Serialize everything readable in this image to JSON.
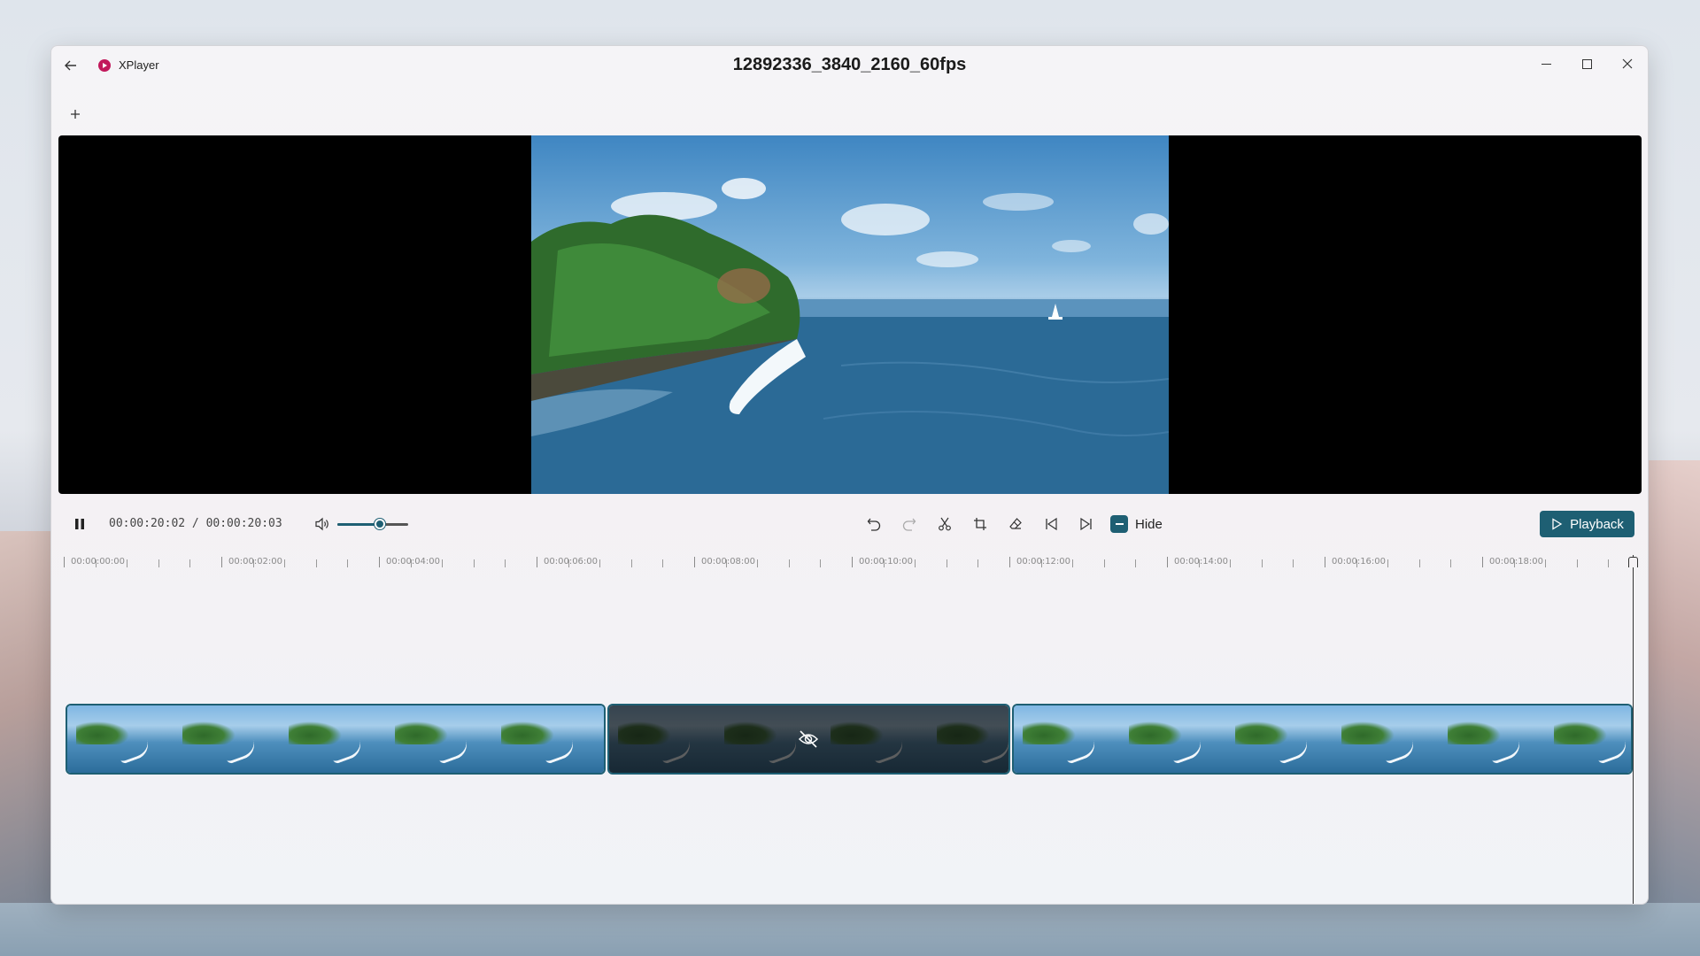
{
  "app": {
    "name": "XPlayer",
    "document_title": "12892336_3840_2160_60fps"
  },
  "player": {
    "current_time": "00:00:20:02",
    "separator": "/",
    "total_time": "00:00:20:03",
    "volume_fraction": 0.6,
    "hide_label": "Hide",
    "playback_label": "Playback"
  },
  "ruler": {
    "labels": [
      "00:00:00:00",
      "00:00:02:00",
      "00:00:04:00",
      "00:00:06:00",
      "00:00:08:00",
      "00:00:10:00",
      "00:00:12:00",
      "00:00:14:00",
      "00:00:16:00",
      "00:00:18:00"
    ]
  },
  "timeline": {
    "segments": [
      {
        "start_s": 0,
        "end_s": 6.92,
        "hidden": false
      },
      {
        "start_s": 6.92,
        "end_s": 12.08,
        "hidden": true
      },
      {
        "start_s": 12.08,
        "end_s": 20.03,
        "hidden": false
      }
    ],
    "playhead_time": "00:00:20:02"
  },
  "colors": {
    "accent": "#1e5f73",
    "logo": "#c2185b"
  }
}
